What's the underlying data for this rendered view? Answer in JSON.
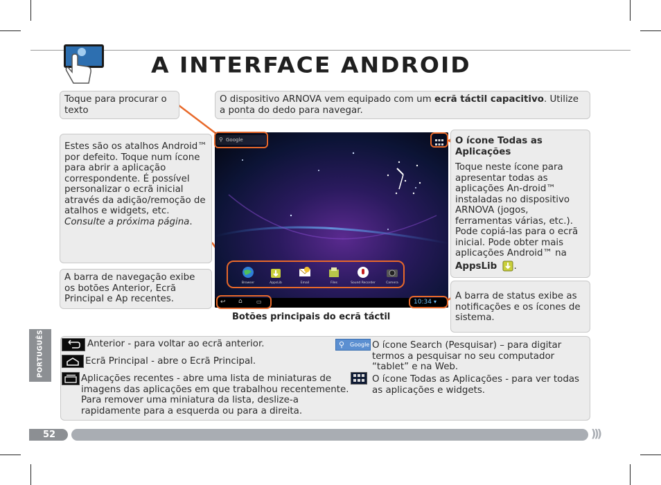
{
  "header": {
    "title": "A INTERFACE ANDROID"
  },
  "callouts": {
    "search": "Toque para procurar o texto",
    "device_before": "O dispositivo ARNOVA vem equipado com um ",
    "device_bold": "ecrã táctil capacitivo",
    "device_after": ". Utilize a ponta do dedo para navegar.",
    "shortcuts_main": "Estes são os atalhos Android™ por defeito. Toque num ícone para abrir a aplicação correspondente. É possível personalizar o ecrã inicial através da adição/remoção de atalhos e widgets, etc. ",
    "shortcuts_italic": "Consulte a próxima página",
    "shortcuts_end": ".",
    "allapps_title": "O ícone Todas as Aplicações",
    "allapps_text": "Toque neste ícone para apresentar todas as aplicações An-droid™ instaladas no dispositivo ARNOVA (jogos, ferramentas várias, etc.). Pode copiá-las para o ecrã inicial. Pode obter mais aplicações Android™ na ",
    "allapps_bold": "AppsLib",
    "allapps_end": ".",
    "navbar": "A barra de navegação exibe os botões Anterior, Ecrã Principal e Ap recentes.",
    "statusbar": "A barra de status exibe as notificações e os ícones de sistema."
  },
  "tablet": {
    "search_label": "Google",
    "time": "10:34",
    "apps": [
      "Browser",
      "AppsLib",
      "Email",
      "Files",
      "Sound Recorder",
      "Camera"
    ]
  },
  "caption": "Botões principais do ecrã táctil",
  "legend": {
    "back": "Anterior - para voltar ao ecrã anterior.",
    "home": "Ecrã Principal - abre o Ecrã Principal.",
    "recent": "Aplicações recentes - abre uma lista de miniaturas de imagens das aplicações em que trabalhou recentemente. Para remover uma miniatura da lista, deslize-a rapidamente para a esquerda ou para a direita.",
    "search": "O ícone Search (Pesquisar) – para digitar termos a pesquisar no seu computador “tablet” e na Web.",
    "allapps": "O ícone Todas as Aplicações - para ver todas as aplicações e widgets.",
    "search_icon_label": "Google"
  },
  "side_tab": "PORTUGUÊS",
  "page_number": "52",
  "colors": {
    "accent": "#e8692a",
    "box_bg": "#ececec",
    "gray_tab": "#8c8f93"
  }
}
